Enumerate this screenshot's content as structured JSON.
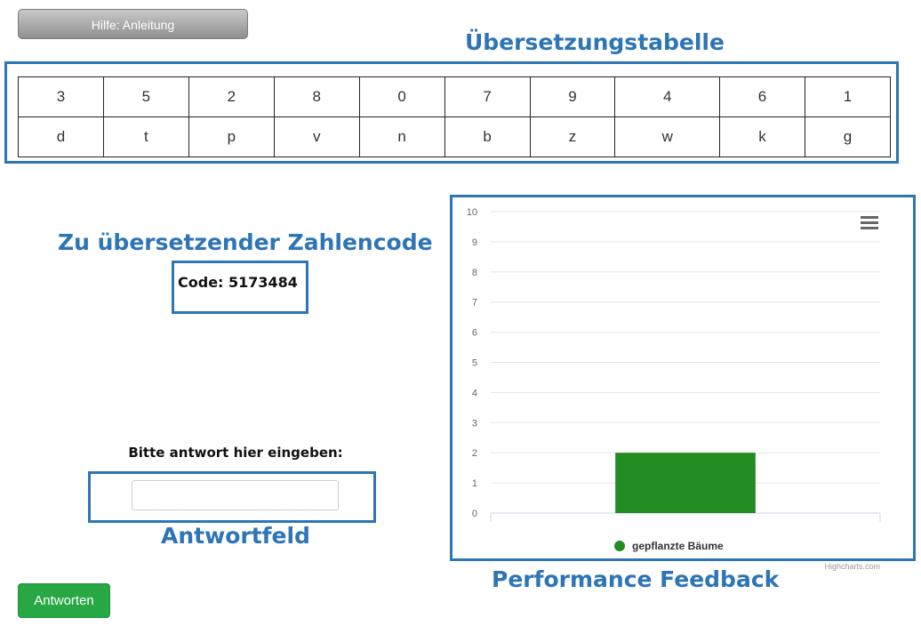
{
  "help_button": {
    "label": "Hilfe: Anleitung"
  },
  "annotations": {
    "table_title": "Übersetzungstabelle",
    "code_title": "Zu übersetzender Zahlencode",
    "answer_title": "Antwortfeld",
    "feedback_title": "Performance Feedback"
  },
  "translation_table": {
    "digits": [
      "3",
      "5",
      "2",
      "8",
      "0",
      "7",
      "9",
      "4",
      "6",
      "1"
    ],
    "letters": [
      "d",
      "t",
      "p",
      "v",
      "n",
      "b",
      "z",
      "w",
      "k",
      "g"
    ]
  },
  "code": {
    "text": "Code: 5173484"
  },
  "answer": {
    "prompt": "Bitte antwort hier eingeben:",
    "value": "",
    "placeholder": ""
  },
  "submit_button": {
    "label": "Antworten"
  },
  "chart_data": {
    "type": "bar",
    "categories": [
      ""
    ],
    "series": [
      {
        "name": "gepflanzte Bäume",
        "values": [
          2
        ],
        "color": "#228b22"
      }
    ],
    "ylim": [
      0,
      10
    ],
    "yticks": [
      0,
      1,
      2,
      3,
      4,
      5,
      6,
      7,
      8,
      9,
      10
    ],
    "grid": true,
    "legend_position": "bottom",
    "credits": "Highcharts.com",
    "menu_icon": "hamburger-menu-icon"
  }
}
